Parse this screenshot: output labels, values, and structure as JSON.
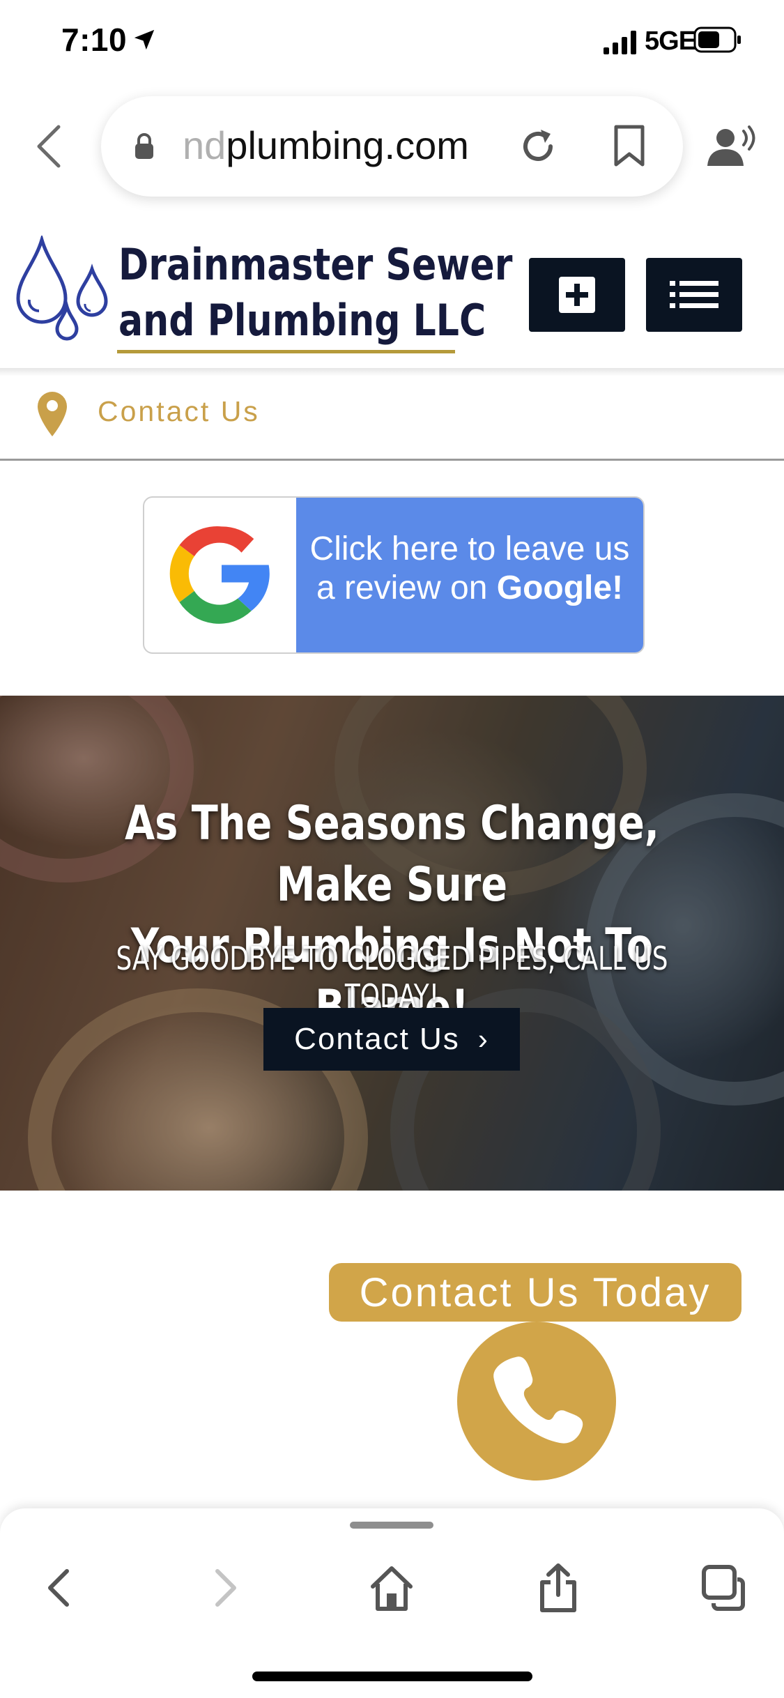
{
  "status_bar": {
    "time": "7:10",
    "network": "5GE"
  },
  "browser": {
    "url_faded_prefix": "nd",
    "url_main": "plumbing.com"
  },
  "header": {
    "brand_line1": "Drainmaster Sewer",
    "brand_line2": "and Plumbing LLC"
  },
  "contact_strip": {
    "label": "Contact Us"
  },
  "review": {
    "line1": "Click here to leave us",
    "line2_prefix": "a review on ",
    "line2_brand": "Google!"
  },
  "hero": {
    "title_line1": "As The Seasons Change, Make Sure",
    "title_line2": "Your Plumbing Is Not To Blame!",
    "subtitle": "SAY GOODBYE TO CLOGGED PIPES, CALL US TODAY!",
    "button_label": "Contact Us",
    "button_chevron": "›"
  },
  "contact_today": {
    "label": "Contact Us Today"
  },
  "colors": {
    "brand_navy": "#151a3c",
    "button_dark": "#0a1422",
    "gold": "#d1a549",
    "google_blue": "#5b8ae8"
  },
  "icons": [
    "location-arrow-icon",
    "signal-icon",
    "battery-icon",
    "back-chevron-icon",
    "lock-icon",
    "reload-icon",
    "bookmark-icon",
    "listen-icon",
    "water-drops-logo-icon",
    "plus-square-icon",
    "menu-list-icon",
    "map-pin-icon",
    "google-g-icon",
    "phone-icon",
    "toolbar-back-icon",
    "toolbar-forward-icon",
    "home-icon",
    "share-icon",
    "tabs-icon"
  ]
}
